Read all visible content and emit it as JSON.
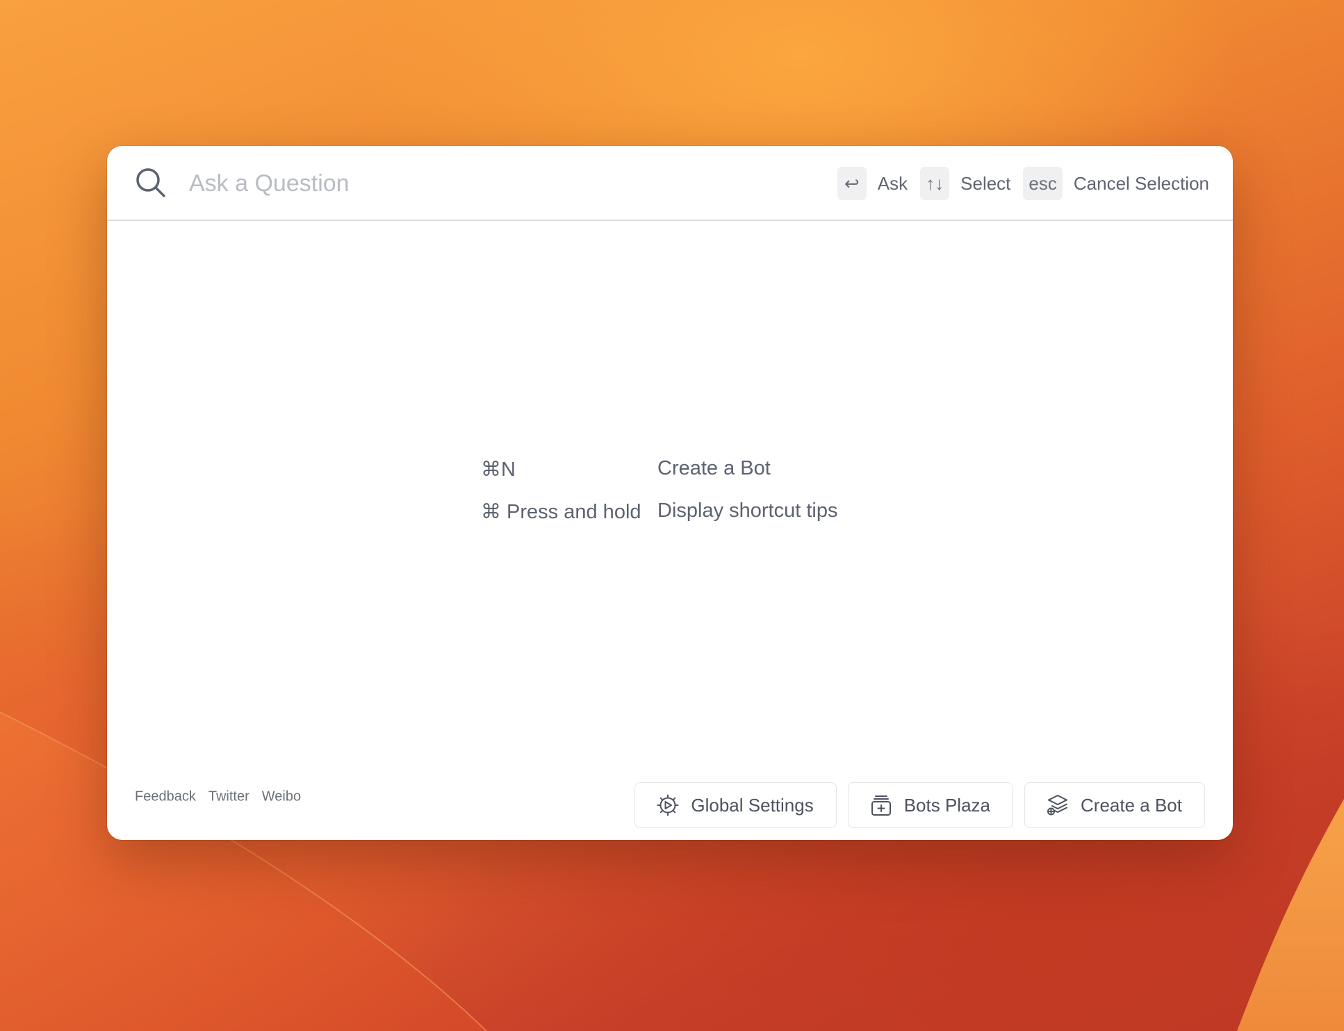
{
  "search": {
    "placeholder": "Ask a Question",
    "value": ""
  },
  "hints": [
    {
      "key": "↩",
      "label": "Ask"
    },
    {
      "key": "↑↓",
      "label": "Select"
    },
    {
      "key": "esc",
      "label": "Cancel Selection"
    }
  ],
  "shortcuts": [
    {
      "keys": "⌘N",
      "action": "Create a Bot"
    },
    {
      "keys": "⌘ Press and hold",
      "action": "Display shortcut tips"
    }
  ],
  "footer": {
    "links": [
      "Feedback",
      "Twitter",
      "Weibo"
    ],
    "buttons": [
      {
        "label": "Global Settings",
        "icon": "settings-gear-icon"
      },
      {
        "label": "Bots Plaza",
        "icon": "bots-plaza-icon"
      },
      {
        "label": "Create a Bot",
        "icon": "create-bot-icon"
      }
    ]
  },
  "colors": {
    "text_primary": "#5d6270",
    "placeholder": "#b9bcc3",
    "key_background": "#f0f0f2",
    "window_background": "#ffffff"
  }
}
